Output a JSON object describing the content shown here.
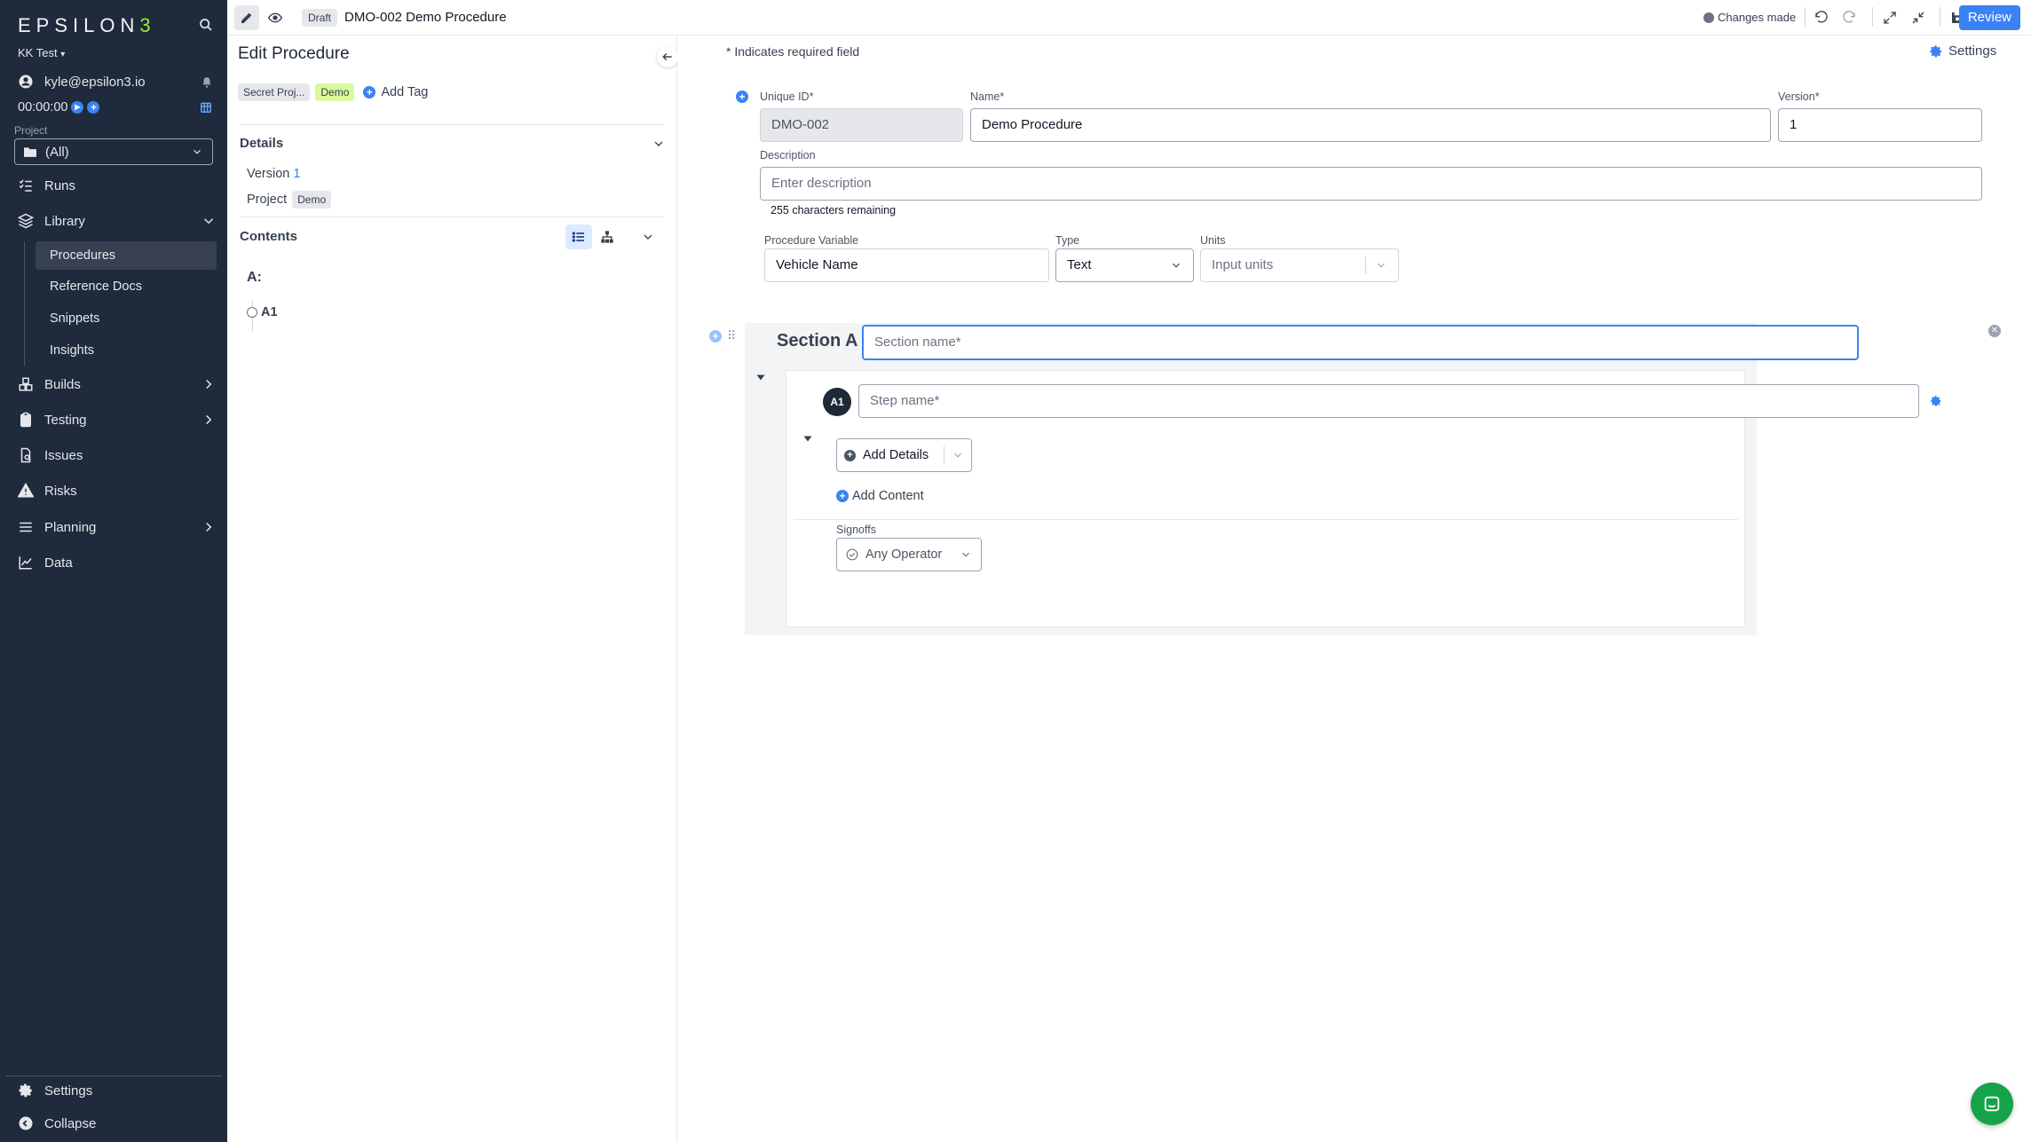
{
  "sidebar": {
    "logo_text": "EPSILON",
    "logo_accent": "3",
    "workspace": "KK Test",
    "user_email": "kyle@epsilon3.io",
    "timer": "00:00:00",
    "project_label": "Project",
    "project_value": "(All)",
    "nav": {
      "runs": "Runs",
      "library": "Library",
      "builds": "Builds",
      "testing": "Testing",
      "issues": "Issues",
      "risks": "Risks",
      "planning": "Planning",
      "data": "Data"
    },
    "library_items": [
      "Procedures",
      "Reference Docs",
      "Snippets",
      "Insights"
    ],
    "settings": "Settings",
    "collapse": "Collapse"
  },
  "topbar": {
    "status_badge": "Draft",
    "title": "DMO-002 Demo Procedure",
    "changes": "Changes made",
    "review": "Review"
  },
  "left_panel": {
    "title": "Edit Procedure",
    "tags": [
      "Secret Proj...",
      "Demo"
    ],
    "add_tag": "Add Tag",
    "details_header": "Details",
    "version_label": "Version",
    "version_value": "1",
    "project_label": "Project",
    "project_value": "Demo",
    "contents_header": "Contents",
    "outline_section": "A:",
    "outline_step": "A1"
  },
  "main": {
    "required_note": "* Indicates required field",
    "settings": "Settings",
    "unique_id_label": "Unique ID*",
    "unique_id_value": "DMO-002",
    "name_label": "Name*",
    "name_value": "Demo Procedure",
    "version_label": "Version*",
    "version_value": "1",
    "description_label": "Description",
    "description_placeholder": "Enter description",
    "chars_remaining": "255 characters remaining",
    "proc_var_label": "Procedure Variable",
    "proc_var_value": "Vehicle Name",
    "type_label": "Type",
    "type_value": "Text",
    "units_label": "Units",
    "units_placeholder": "Input units",
    "section_title": "Section A",
    "section_name_placeholder": "Section name*",
    "step_badge": "A1",
    "step_name_placeholder": "Step name*",
    "add_details": "Add Details",
    "add_content": "Add Content",
    "signoffs_label": "Signoffs",
    "signoff_value": "Any Operator"
  },
  "colors": {
    "sidebar_bg": "#1f2a3c",
    "accent_blue": "#3b82f6",
    "demo_tag": "#d9f99d"
  }
}
